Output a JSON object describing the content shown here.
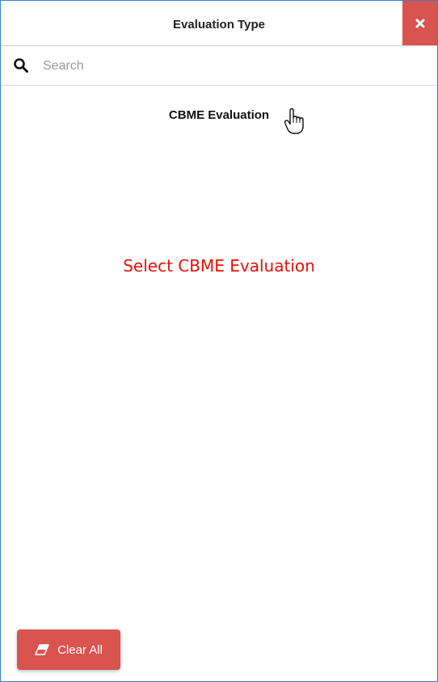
{
  "dialog": {
    "title": "Evaluation Type",
    "close_icon": "close-icon"
  },
  "search": {
    "placeholder": "Search",
    "value": "",
    "icon": "search-icon"
  },
  "options": [
    {
      "label": "CBME Evaluation"
    }
  ],
  "instruction": "Select CBME Evaluation",
  "footer": {
    "clear_label": "Clear All",
    "clear_icon": "eraser-icon"
  },
  "colors": {
    "accent": "#d9534f",
    "border": "#3b7fc4",
    "instruction": "#e8100a"
  }
}
